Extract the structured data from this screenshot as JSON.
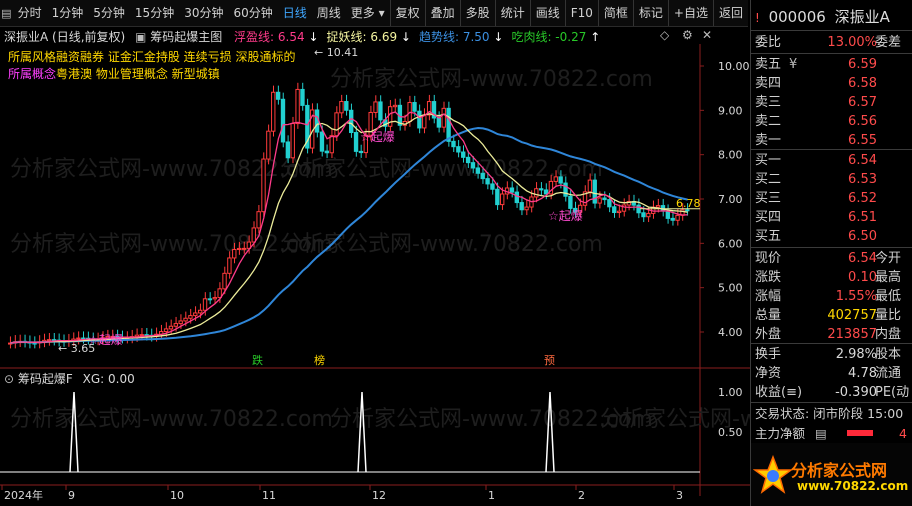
{
  "toolbar": {
    "left_items": [
      "分时",
      "1分钟",
      "5分钟",
      "15分钟",
      "30分钟",
      "60分钟",
      "日线",
      "周线",
      "更多"
    ],
    "active": "日线",
    "right_items": [
      "复权",
      "叠加",
      "多股",
      "统计",
      "画线",
      "F10",
      "简框",
      "标记",
      "+自选",
      "返回"
    ]
  },
  "chart_header": {
    "stock": "深振业A (日线,前复权)",
    "indicator_name": "筹码起爆主图",
    "legend": [
      {
        "label": "浮盈线: 6.54",
        "color": "#ff3b8a",
        "arrow": "↓"
      },
      {
        "label": "捉妖线: 6.69",
        "color": "#f5f5a0",
        "arrow": "↓"
      },
      {
        "label": "趋势线: 7.50",
        "color": "#3b8fe0",
        "arrow": "↓"
      },
      {
        "label": "吃肉线: -0.27",
        "color": "#28c828",
        "arrow": "↑"
      }
    ]
  },
  "concepts": {
    "line1_label": "所属风格",
    "line1_value": "融资融券 证金汇金持股 连续亏损 深股通标的",
    "line2_label": "所属概念",
    "line2_value": "粤港澳 物业管理概念 新型城镇"
  },
  "price_axis": [
    "10.00",
    "9.00",
    "8.00",
    "7.00",
    "6.00",
    "5.00",
    "4.00"
  ],
  "price_labels": {
    "high": "10.41",
    "low": "3.65",
    "last": "6.78"
  },
  "signals": {
    "qiba": "起爆",
    "die": "跌",
    "bang": "榜",
    "yu": "预"
  },
  "sub_chart": {
    "title": "筹码起爆F",
    "value": "XG: 0.00",
    "axis": [
      "1.00",
      "0.50"
    ]
  },
  "time_axis": [
    "2024年",
    "9",
    "10",
    "11",
    "12",
    "1",
    "2",
    "3"
  ],
  "chart_data": {
    "type": "line",
    "series": [
      {
        "name": "趋势线",
        "values": [
          7.5
        ]
      },
      {
        "name": "捉妖线",
        "values": [
          6.69
        ]
      },
      {
        "name": "浮盈线",
        "values": [
          6.54
        ]
      }
    ],
    "ylim": [
      3.5,
      10.8
    ]
  },
  "panel": {
    "code": "000006",
    "name": "深振业A",
    "weibi_label": "委比",
    "weibi_value": "13.00%",
    "weicha_label": "委差",
    "asks": [
      {
        "label": "卖五",
        "price": "6.59"
      },
      {
        "label": "卖四",
        "price": "6.58"
      },
      {
        "label": "卖三",
        "price": "6.57"
      },
      {
        "label": "卖二",
        "price": "6.56"
      },
      {
        "label": "卖一",
        "price": "6.55"
      }
    ],
    "ask_currency": "¥",
    "bids": [
      {
        "label": "买一",
        "price": "6.54"
      },
      {
        "label": "买二",
        "price": "6.53"
      },
      {
        "label": "买三",
        "price": "6.52"
      },
      {
        "label": "买四",
        "price": "6.51"
      },
      {
        "label": "买五",
        "price": "6.50"
      }
    ],
    "stats": [
      {
        "label": "现价",
        "value": "6.54",
        "right": "今开",
        "cls": "red"
      },
      {
        "label": "涨跌",
        "value": "0.10",
        "right": "最高",
        "cls": "red"
      },
      {
        "label": "涨幅",
        "value": "1.55%",
        "right": "最低",
        "cls": "red"
      },
      {
        "label": "总量",
        "value": "402757",
        "right": "量比",
        "cls": "yellow"
      },
      {
        "label": "外盘",
        "value": "213857",
        "right": "内盘",
        "cls": "red"
      }
    ],
    "stats2": [
      {
        "label": "换手",
        "value": "2.98%",
        "right": "股本"
      },
      {
        "label": "净资",
        "value": "4.78",
        "right": "流通"
      },
      {
        "label": "收益(≡)",
        "value": "-0.390",
        "right": "PE(动"
      }
    ],
    "trade_status": "交易状态: 闭市阶段 15:00",
    "net_label": "主力净额",
    "net_value": "4"
  },
  "watermark": "分析家公式网",
  "logo_text": "分析家公式网",
  "logo_url": "www.70822.com"
}
